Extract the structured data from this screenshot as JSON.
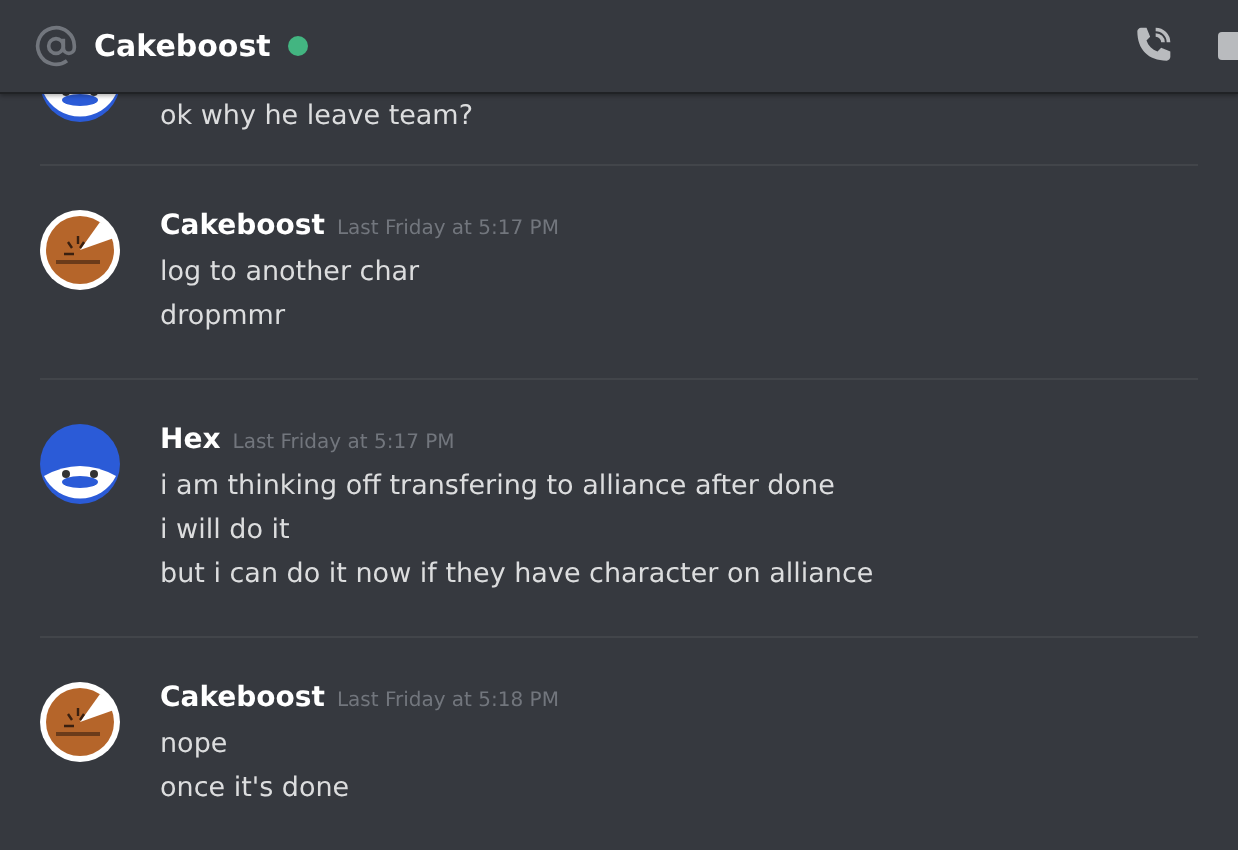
{
  "header": {
    "title": "Cakeboost",
    "online": true
  },
  "messages": [
    {
      "kind": "hex",
      "lines": [
        "ok why he leave team?"
      ]
    },
    {
      "kind": "cake",
      "author": "Cakeboost",
      "timestamp": "Last Friday at 5:17 PM",
      "lines": [
        "log to another char",
        "dropmmr"
      ]
    },
    {
      "kind": "hex",
      "author": "Hex",
      "timestamp": "Last Friday at 5:17 PM",
      "lines": [
        "i am thinking off transfering to alliance after done",
        "i will do it",
        "but i can do it now if they have character on alliance"
      ]
    },
    {
      "kind": "cake",
      "author": "Cakeboost",
      "timestamp": "Last Friday at 5:18 PM",
      "lines": [
        "nope",
        "once it's done"
      ]
    }
  ]
}
